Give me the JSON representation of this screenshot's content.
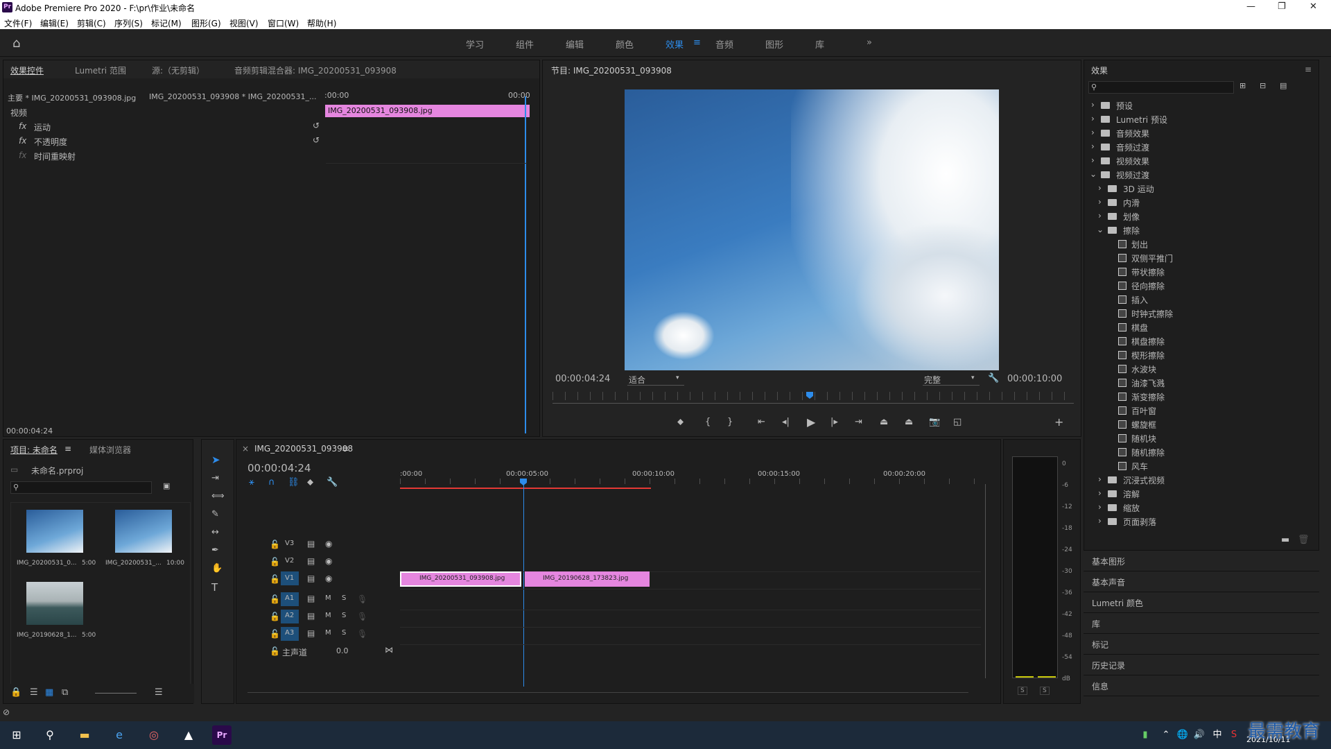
{
  "app": {
    "title": "Adobe Premiere Pro 2020 - F:\\pr\\作业\\未命名",
    "logo": "Pr"
  },
  "menu": [
    "文件(F)",
    "编辑(E)",
    "剪辑(C)",
    "序列(S)",
    "标记(M)",
    "图形(G)",
    "视图(V)",
    "窗口(W)",
    "帮助(H)"
  ],
  "workspaces": [
    "学习",
    "组件",
    "编辑",
    "颜色",
    "效果",
    "音频",
    "图形",
    "库"
  ],
  "workspace_active": "效果",
  "effect_controls": {
    "tabs": [
      "效果控件",
      "Lumetri 范围",
      "源:（无剪辑）",
      "音频剪辑混合器: IMG_20200531_093908"
    ],
    "master": "主要 * IMG_20200531_093908.jpg",
    "sequence": "IMG_20200531_093908 * IMG_20200531_...",
    "time_start": ":00:00",
    "time_end": "00:00",
    "clip": "IMG_20200531_093908.jpg",
    "section": "视频",
    "rows": [
      "运动",
      "不透明度",
      "时间重映射"
    ],
    "timecode": "00:00:04:24"
  },
  "program": {
    "title": "节目: IMG_20200531_093908",
    "timecode": "00:00:04:24",
    "fit": "适合",
    "quality": "完整",
    "duration": "00:00:10:00"
  },
  "effects": {
    "title": "效果",
    "search_placeholder": "",
    "top": [
      "预设",
      "Lumetri 预设",
      "音频效果",
      "音频过渡",
      "视频效果",
      "视频过渡"
    ],
    "video_transitions": [
      "3D 运动",
      "内滑",
      "划像",
      "擦除"
    ],
    "wipes": [
      "划出",
      "双侧平推门",
      "带状擦除",
      "径向擦除",
      "插入",
      "时钟式擦除",
      "棋盘",
      "棋盘擦除",
      "楔形擦除",
      "水波块",
      "油漆飞溅",
      "渐变擦除",
      "百叶窗",
      "螺旋框",
      "随机块",
      "随机擦除",
      "风车"
    ],
    "after": [
      "沉浸式视频",
      "溶解",
      "缩放",
      "页面剥落"
    ],
    "panels": [
      "基本图形",
      "基本声音",
      "Lumetri 颜色",
      "库",
      "标记",
      "历史记录",
      "信息"
    ]
  },
  "project": {
    "tabs": [
      "项目: 未命名",
      "媒体浏览器"
    ],
    "file": "未命名.prproj",
    "items": [
      {
        "name": "IMG_20200531_0...",
        "dur": "5:00"
      },
      {
        "name": "IMG_20200531_...",
        "dur": "10:00"
      },
      {
        "name": "IMG_20190628_1...",
        "dur": "5:00"
      }
    ]
  },
  "timeline": {
    "title": "IMG_20200531_093908",
    "timecode": "00:00:04:24",
    "ticks": [
      ":00:00",
      "00:00:05:00",
      "00:00:10:00",
      "00:00:15:00",
      "00:00:20:00"
    ],
    "video_tracks": [
      "V3",
      "V2",
      "V1"
    ],
    "audio_tracks": [
      "A1",
      "A2",
      "A3"
    ],
    "master": "主声道",
    "master_val": "0.0",
    "clips": [
      "IMG_20200531_093908.jpg",
      "IMG_20190628_173823.jpg"
    ]
  },
  "meter": {
    "labels": [
      "0",
      "-6",
      "-12",
      "-18",
      "-24",
      "-30",
      "-36",
      "-42",
      "-48",
      "-54",
      "dB"
    ],
    "solo": [
      "S",
      "S"
    ]
  },
  "taskbar": {
    "time": "",
    "date": "2021/10/11",
    "watermark": "最需教育"
  }
}
